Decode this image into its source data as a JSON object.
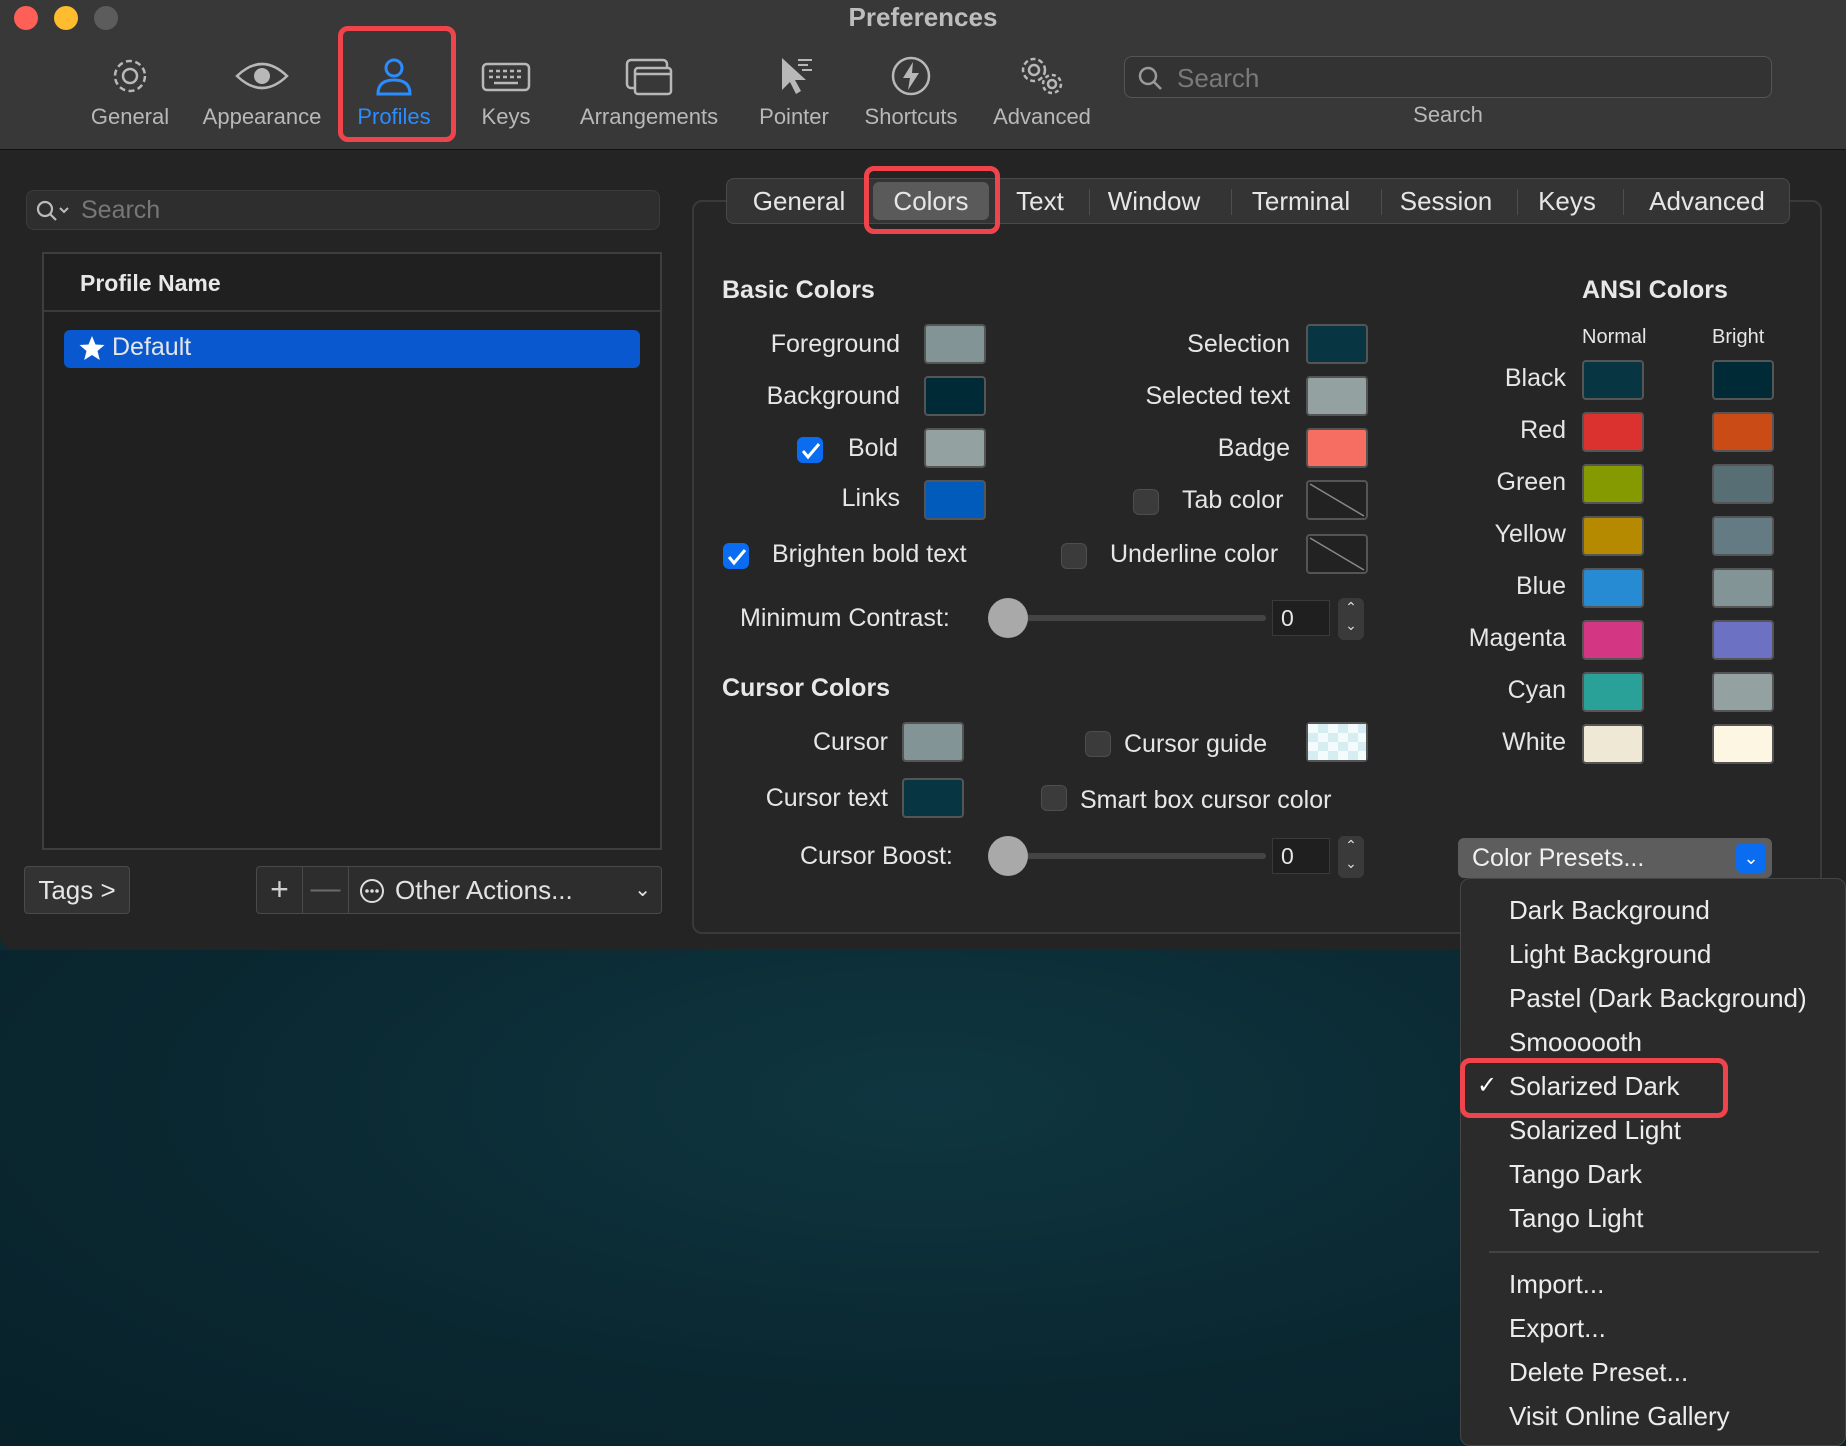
{
  "window": {
    "title": "Preferences"
  },
  "toolbar": {
    "items": [
      {
        "label": "General",
        "icon": "gear-icon"
      },
      {
        "label": "Appearance",
        "icon": "eye-icon"
      },
      {
        "label": "Profiles",
        "icon": "person-icon"
      },
      {
        "label": "Keys",
        "icon": "keyboard-icon"
      },
      {
        "label": "Arrangements",
        "icon": "windows-icon"
      },
      {
        "label": "Pointer",
        "icon": "pointer-icon"
      },
      {
        "label": "Shortcuts",
        "icon": "bolt-icon"
      },
      {
        "label": "Advanced",
        "icon": "gears-icon"
      }
    ],
    "active": "Profiles",
    "search": {
      "placeholder": "Search",
      "label": "Search"
    }
  },
  "sidebar": {
    "search_placeholder": "Search",
    "column_header": "Profile Name",
    "profiles": [
      {
        "name": "Default",
        "starred": true,
        "selected": true
      }
    ],
    "tags_button": "Tags >",
    "add_button": "+",
    "remove_button": "—",
    "other_actions": "Other Actions..."
  },
  "tabs": {
    "items": [
      "General",
      "Colors",
      "Text",
      "Window",
      "Terminal",
      "Session",
      "Keys",
      "Advanced"
    ],
    "active": "Colors"
  },
  "basic_colors": {
    "title": "Basic Colors",
    "foreground": {
      "label": "Foreground",
      "color": "#839496"
    },
    "background": {
      "label": "Background",
      "color": "#002b36"
    },
    "bold": {
      "label": "Bold",
      "color": "#93a1a1",
      "checked": true
    },
    "links": {
      "label": "Links",
      "color": "#005bbb"
    },
    "selection": {
      "label": "Selection",
      "color": "#073642"
    },
    "selected_text": {
      "label": "Selected text",
      "color": "#93a1a1"
    },
    "badge": {
      "label": "Badge",
      "color": "#f56e61"
    },
    "tab_color": {
      "label": "Tab color",
      "checked": false
    },
    "brighten_bold": {
      "label": "Brighten bold text",
      "checked": true
    },
    "underline_color": {
      "label": "Underline color",
      "checked": false
    },
    "min_contrast": {
      "label": "Minimum Contrast:",
      "value": "0"
    }
  },
  "cursor_colors": {
    "title": "Cursor Colors",
    "cursor": {
      "label": "Cursor",
      "color": "#839496"
    },
    "cursor_text": {
      "label": "Cursor text",
      "color": "#073642"
    },
    "cursor_guide": {
      "label": "Cursor guide",
      "checked": false
    },
    "smart_box": {
      "label": "Smart box cursor color",
      "checked": false
    },
    "cursor_boost": {
      "label": "Cursor Boost:",
      "value": "0"
    }
  },
  "ansi_colors": {
    "title": "ANSI Colors",
    "normal_header": "Normal",
    "bright_header": "Bright",
    "rows": [
      {
        "name": "Black",
        "normal": "#073642",
        "bright": "#002b36"
      },
      {
        "name": "Red",
        "normal": "#dc322f",
        "bright": "#cb4b16"
      },
      {
        "name": "Green",
        "normal": "#859900",
        "bright": "#586e75"
      },
      {
        "name": "Yellow",
        "normal": "#b58900",
        "bright": "#657b83"
      },
      {
        "name": "Blue",
        "normal": "#268bd2",
        "bright": "#839496"
      },
      {
        "name": "Magenta",
        "normal": "#d33682",
        "bright": "#6c71c4"
      },
      {
        "name": "Cyan",
        "normal": "#2aa198",
        "bright": "#93a1a1"
      },
      {
        "name": "White",
        "normal": "#eee8d5",
        "bright": "#fdf6e3"
      }
    ]
  },
  "presets": {
    "button_label": "Color Presets...",
    "menu": [
      "Dark Background",
      "Light Background",
      "Pastel (Dark Background)",
      "Smoooooth",
      "Solarized Dark",
      "Solarized Light",
      "Tango Dark",
      "Tango Light"
    ],
    "selected": "Solarized Dark",
    "actions": [
      "Import...",
      "Export...",
      "Delete Preset...",
      "Visit Online Gallery"
    ]
  },
  "colors": {
    "accent": "#0a6cf0",
    "highlight_box": "#f0444c",
    "profiles_active": "#2b8cff"
  }
}
